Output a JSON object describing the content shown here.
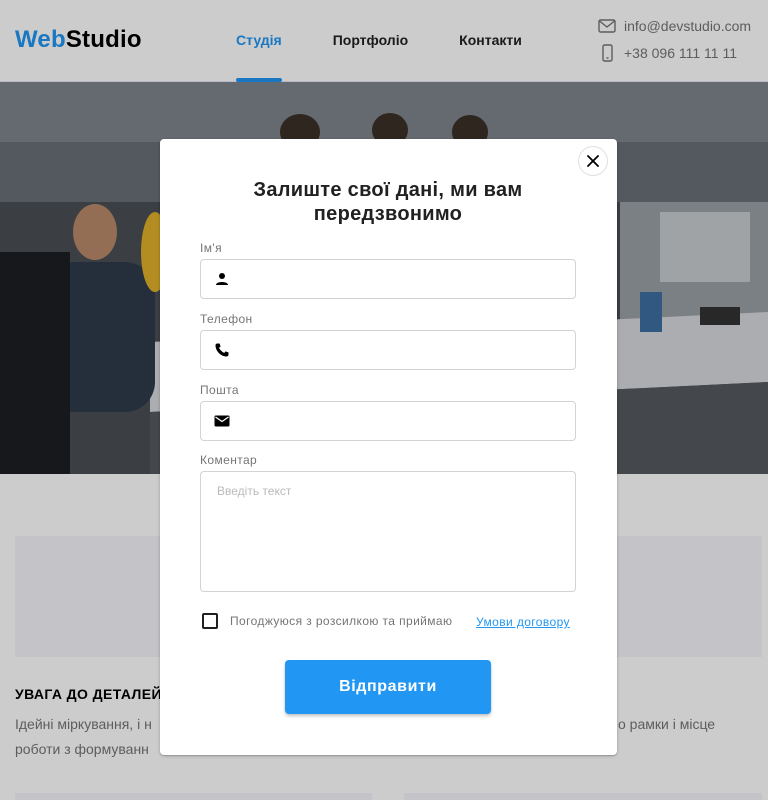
{
  "header": {
    "logo_part1": "Web",
    "logo_part2": "Studio",
    "nav": [
      "Студія",
      "Портфоліо",
      "Контакти"
    ],
    "email": "info@devstudio.com",
    "phone": "+38 096 111 11 11"
  },
  "hero": {
    "image": "office-meeting-photo"
  },
  "section": {
    "title": "УВАГА ДО ДЕТАЛЕЙ",
    "text_left_1": "Ідейні міркування, і н",
    "text_left_2": "роботи з формуванн",
    "text_right_1": "о рамки і місце",
    "text_right_2": ""
  },
  "modal": {
    "title": "Залиште свої дані, ми вам передзвонимо",
    "name_label": "Ім'я",
    "name_value": "",
    "phone_label": "Телефон",
    "phone_value": "",
    "email_label": "Пошта",
    "email_value": "",
    "comment_label": "Коментар",
    "comment_placeholder": "Введіть текст",
    "agree_text": "Погоджуюся з розсилкою та приймаю",
    "agree_link": "Умови договору",
    "agree_checked": false,
    "submit_label": "Відправити"
  },
  "colors": {
    "accent": "#2196f3",
    "text": "#212121",
    "muted": "#757575"
  }
}
